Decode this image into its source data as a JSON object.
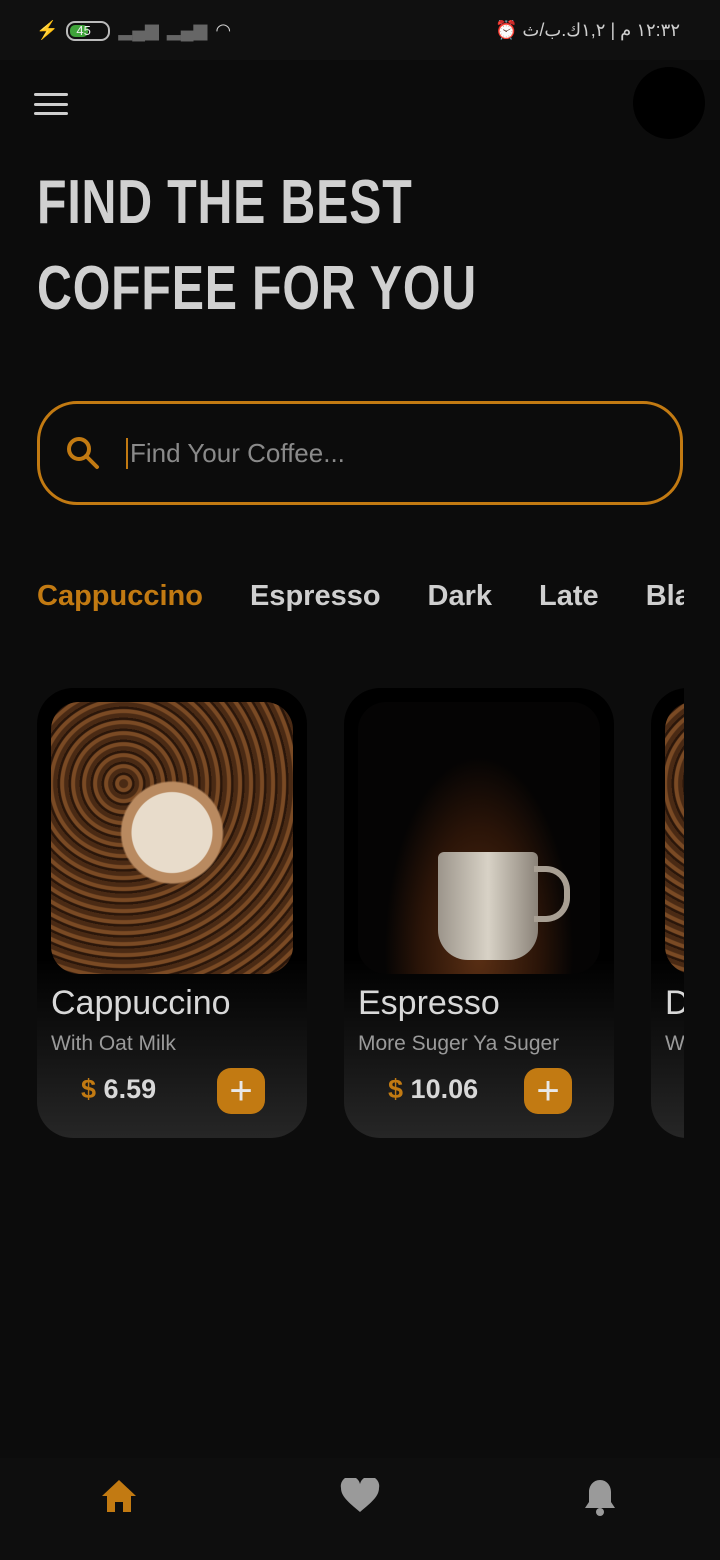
{
  "status": {
    "battery": "45",
    "time": "١٢:٣٢ م | ١,٢ك.ب/ث"
  },
  "header": {
    "title_line1": "FIND THE BEST",
    "title_line2": "COFFEE FOR YOU"
  },
  "search": {
    "placeholder": "Find Your Coffee...",
    "value": ""
  },
  "tabs": [
    {
      "label": "Cappuccino",
      "active": true
    },
    {
      "label": "Espresso"
    },
    {
      "label": "Dark"
    },
    {
      "label": "Late"
    },
    {
      "label": "Black"
    }
  ],
  "products": [
    {
      "name": "Cappuccino",
      "subtitle": "With Oat Milk",
      "currency": "$",
      "price": "6.59"
    },
    {
      "name": "Espresso",
      "subtitle": "More Suger Ya Suger",
      "currency": "$",
      "price": "10.06"
    },
    {
      "name": "D",
      "subtitle": "W"
    }
  ],
  "colors": {
    "accent": "#c27a12",
    "background": "#0c0c0c"
  },
  "nav": {
    "items": [
      "home-icon",
      "heart-icon",
      "bell-icon"
    ],
    "active": "home-icon"
  }
}
